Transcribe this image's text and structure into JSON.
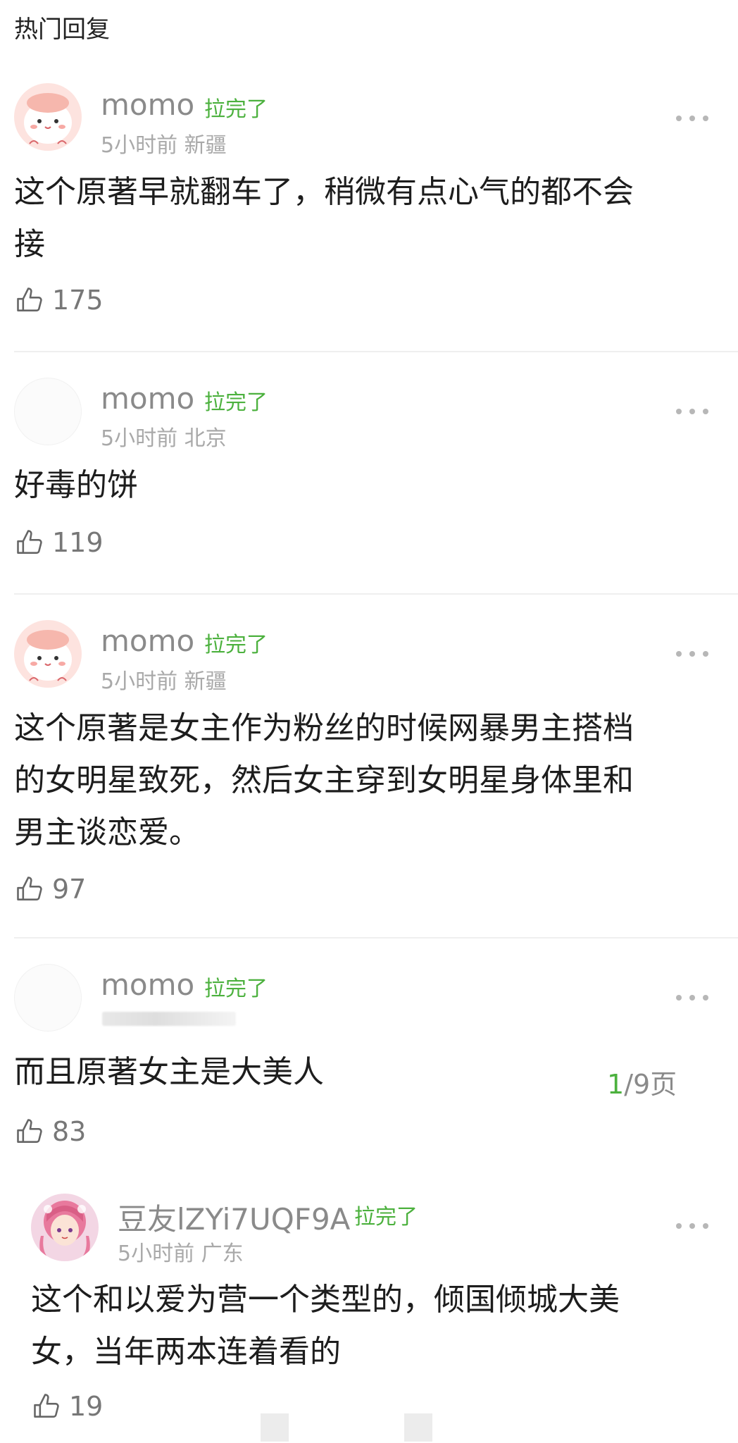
{
  "section_title": "热门回复",
  "comments": [
    {
      "username": "momo",
      "badge": "拉完了",
      "time": "5小时前",
      "location": "新疆",
      "text_lines": [
        "这个原著早就翻车了，稍微有点心气的都不会",
        "接"
      ],
      "likes": "175",
      "avatar": "cute-cat-avatar"
    },
    {
      "username": "momo",
      "badge": "拉完了",
      "time": "5小时前",
      "location": "北京",
      "text_lines": [
        "好毒的饼"
      ],
      "likes": "119",
      "avatar": "blank-avatar"
    },
    {
      "username": "momo",
      "badge": "拉完了",
      "time": "5小时前",
      "location": "新疆",
      "text_lines": [
        "这个原著是女主作为粉丝的时候网暴男主搭档",
        "的女明星致死，然后女主穿到女明星身体里和",
        "男主谈恋爱。"
      ],
      "likes": "97",
      "avatar": "cute-cat-avatar"
    },
    {
      "username": "momo",
      "badge": "拉完了",
      "text_lines": [
        "而且原著女主是大美人"
      ],
      "likes": "83",
      "avatar": "blank-avatar"
    }
  ],
  "pager": {
    "current": "1",
    "total": "/9页"
  },
  "reply": {
    "username": "豆友lZYi7UQF9A",
    "badge": "拉完了",
    "time": "5小时前",
    "location": "广东",
    "text_lines": [
      "这个和以爱为营一个类型的，倾国倾城大美",
      "女，当年两本连着看的"
    ],
    "likes": "19",
    "avatar": "anime-girl-avatar"
  },
  "icons": {
    "like": "thumbs-up-icon",
    "more": "more-dots-icon"
  },
  "colors": {
    "badge": "#4cb13e",
    "meta": "#a9a9a9",
    "username": "#8a8a8a"
  }
}
